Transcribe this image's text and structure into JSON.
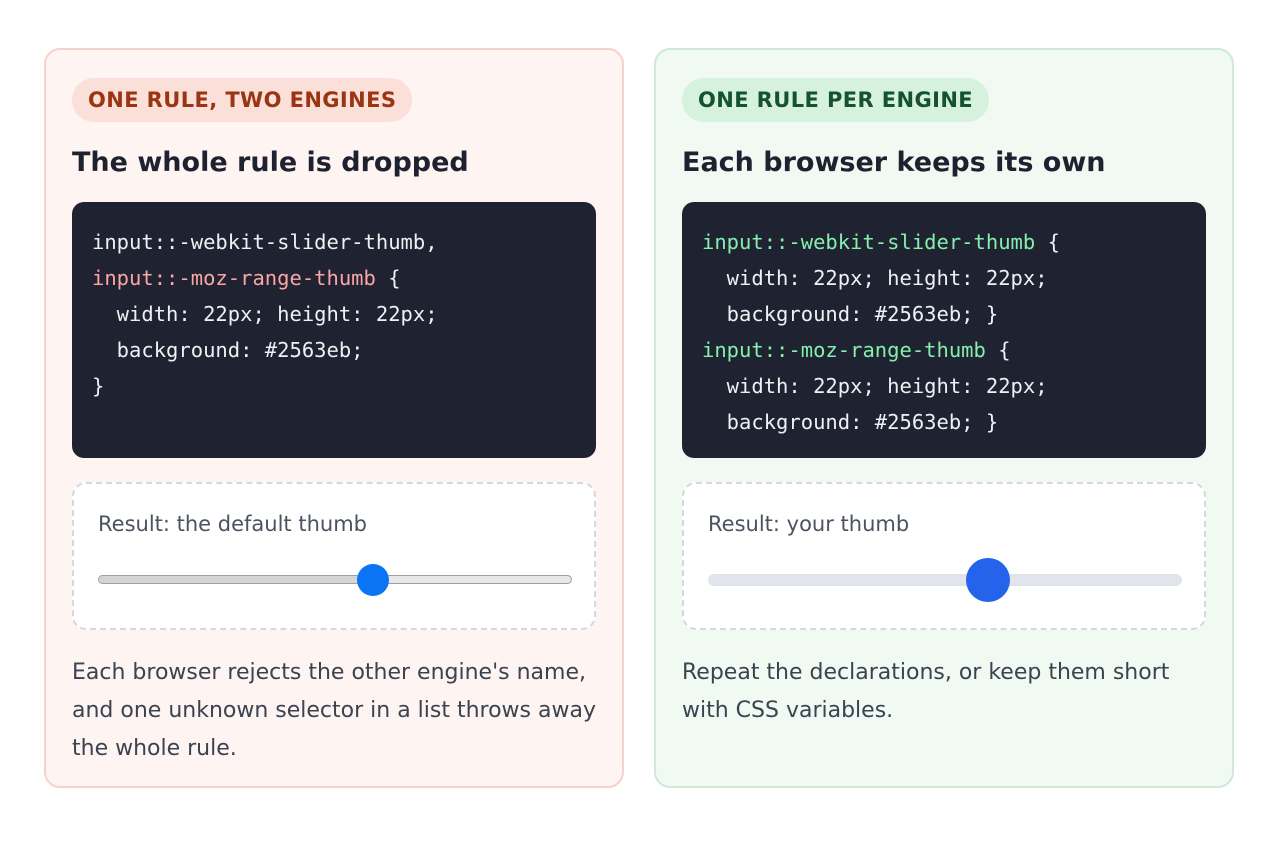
{
  "left_card": {
    "badge": "ONE RULE, TWO ENGINES",
    "heading": "The whole rule is dropped",
    "code": {
      "line1": "input::-webkit-slider-thumb,",
      "line2_selector": "input::-moz-range-thumb",
      "line2_rest": " {",
      "line3": "  width: 22px; height: 22px;",
      "line4": "  background: #2563eb;",
      "line5": "}"
    },
    "result_label": "Result: the default thumb",
    "slider_value_percent": 58,
    "description": "Each browser rejects the other engine's name, and one unknown selector in a list throws away the whole rule."
  },
  "right_card": {
    "badge": "ONE RULE PER ENGINE",
    "heading": "Each browser keeps its own",
    "code": {
      "line1_selector": "input::-webkit-slider-thumb",
      "line1_rest": " {",
      "line2": "  width: 22px; height: 22px;",
      "line3": "  background: #2563eb; }",
      "line4_selector": "input::-moz-range-thumb",
      "line4_rest": " {",
      "line5": "  width: 22px; height: 22px;",
      "line6": "  background: #2563eb; }"
    },
    "result_label": "Result: your thumb",
    "slider_value_percent": 59,
    "description": "Repeat the declarations, or keep them short with CSS variables."
  },
  "colors": {
    "thumb_custom": "#2563eb",
    "thumb_default": "#0a74f5",
    "bad_accent": "#9a3412",
    "good_accent": "#14532d"
  }
}
